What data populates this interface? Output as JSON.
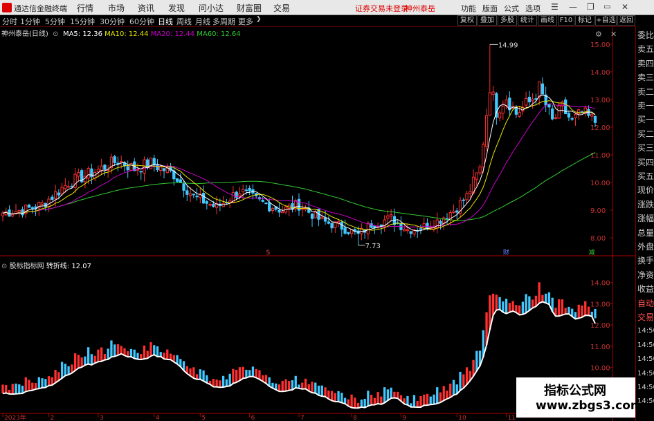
{
  "titlebar": {
    "app_title": "通达信金融终端",
    "menus": [
      "行情",
      "市场",
      "资讯",
      "发现",
      "问小达",
      "财富圈",
      "交易"
    ],
    "login_status": "证券交易未登录",
    "stock_link": "神州泰岳",
    "right_menus": [
      "功能",
      "版面",
      "公式",
      "选项"
    ],
    "restore_mark": "R",
    "close_mark": "X"
  },
  "period_tabs": [
    "分时",
    "1分钟",
    "5分钟",
    "15分钟",
    "30分钟",
    "60分钟",
    "日线",
    "周线",
    "月线",
    "多周期",
    "更多"
  ],
  "active_tab": "日线",
  "toolbar": [
    "复权",
    "叠加",
    "多股",
    "统计",
    "画线",
    "F10",
    "标记",
    "+自选",
    "返回"
  ],
  "main_panel": {
    "stock": "神州泰岳(日线)",
    "ma": [
      {
        "label": "MA5: 12.36",
        "color": "#ffffff"
      },
      {
        "label": "MA10: 12.44",
        "color": "#e8e800"
      },
      {
        "label": "MA20: 12.44",
        "color": "#cc00cc"
      },
      {
        "label": "MA60: 12.64",
        "color": "#33cc33"
      }
    ],
    "high_mark": "14.99",
    "low_mark": "7.73",
    "markers": [
      "S",
      "财",
      "减"
    ]
  },
  "indicator_panel": {
    "name": "股标指标网",
    "line_label": "转折线: 12.07"
  },
  "right_sidebar": [
    "委比",
    "卖五",
    "卖四",
    "卖三",
    "卖二",
    "卖一",
    "买一",
    "买二",
    "买三",
    "买四",
    "买五",
    "现价",
    "涨跌",
    "涨幅",
    "总量",
    "外盘",
    "换手",
    "净资",
    "收益",
    "自动",
    "交易",
    "14:50",
    "14:50",
    "14:50",
    "14:50",
    "14:50",
    "14:50"
  ],
  "watermark": {
    "line1": "指标公式网",
    "line2": "www.zbgs3.com"
  },
  "colors": {
    "up": "#ff3030",
    "down": "#40c8ff",
    "ma5": "#ffffff",
    "ma10": "#e8e800",
    "ma20": "#cc00cc",
    "ma60": "#33cc33",
    "turn": "#ffffff",
    "axis": "#b00000"
  },
  "chart_data": [
    {
      "type": "candlestick",
      "title": "神州泰岳(日线)",
      "yaxis_ticks": [
        "15.00",
        "14.00",
        "13.00",
        "12.00",
        "11.00",
        "10.00",
        "9.00",
        "8.00"
      ],
      "ylim": [
        7.5,
        15.3
      ],
      "x_ticks": [
        "2023年",
        "2",
        "3",
        "4",
        "5",
        "6",
        "7",
        "8",
        "9",
        "10",
        "11"
      ],
      "high": 14.99,
      "low": 7.73,
      "close_anchors": [
        [
          0,
          8.9
        ],
        [
          6,
          9.0
        ],
        [
          12,
          9.2
        ],
        [
          20,
          10.0
        ],
        [
          28,
          10.4
        ],
        [
          35,
          10.8
        ],
        [
          40,
          10.5
        ],
        [
          45,
          10.7
        ],
        [
          52,
          10.3
        ],
        [
          58,
          9.5
        ],
        [
          65,
          9.1
        ],
        [
          72,
          9.7
        ],
        [
          78,
          9.3
        ],
        [
          85,
          9.0
        ],
        [
          90,
          9.2
        ],
        [
          97,
          8.6
        ],
        [
          103,
          8.4
        ],
        [
          108,
          8.1
        ],
        [
          112,
          8.5
        ],
        [
          118,
          8.7
        ],
        [
          123,
          8.3
        ],
        [
          128,
          8.4
        ],
        [
          132,
          8.6
        ],
        [
          137,
          9.0
        ],
        [
          141,
          9.5
        ],
        [
          145,
          10.5
        ],
        [
          148,
          13.5
        ],
        [
          150,
          12.6
        ],
        [
          153,
          13.1
        ],
        [
          156,
          12.5
        ],
        [
          160,
          12.9
        ],
        [
          163,
          13.4
        ],
        [
          167,
          12.2
        ],
        [
          170,
          12.7
        ],
        [
          173,
          12.2
        ],
        [
          176,
          12.5
        ],
        [
          180,
          12.2
        ]
      ]
    },
    {
      "type": "bar",
      "title": "股标指标网",
      "series": [
        {
          "name": "转折线",
          "last": 12.07
        }
      ],
      "yaxis_ticks": [
        "14.00",
        "13.00",
        "12.00",
        "11.00",
        "10.00"
      ],
      "ylim": [
        8.0,
        15.0
      ]
    }
  ]
}
